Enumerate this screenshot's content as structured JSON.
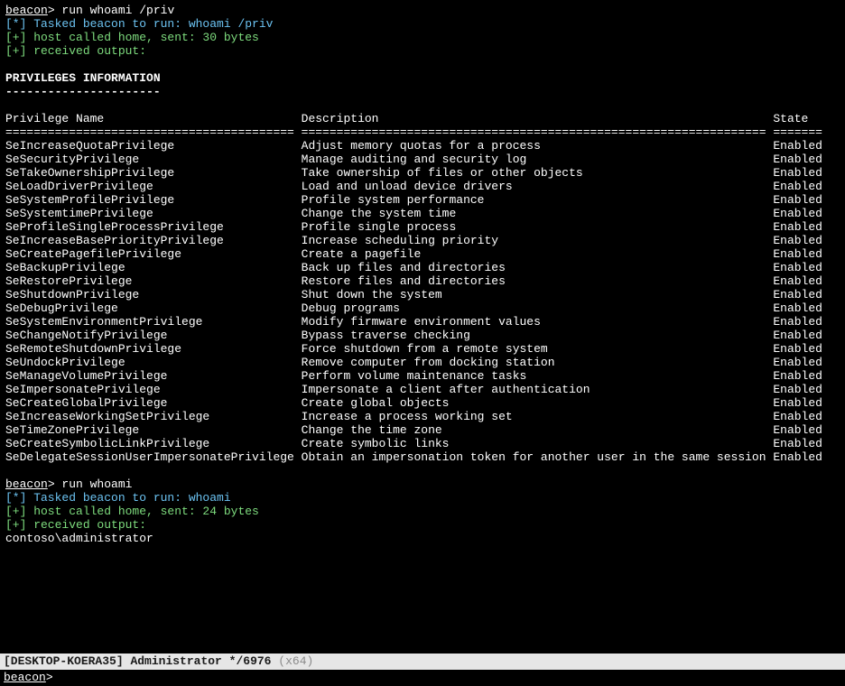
{
  "prompt_label": "beacon",
  "prompt_sep": ">",
  "cmd1": "run whoami /priv",
  "task1": "[*] Tasked beacon to run: whoami /priv",
  "home1": "[+] host called home, sent: 30 bytes",
  "recv1": "[+] received output:",
  "section_title": "PRIVILEGES INFORMATION",
  "section_rule": "----------------------",
  "col1_header": "Privilege Name",
  "col2_header": "Description",
  "col3_header": "State",
  "rows": [
    {
      "name": "SeIncreaseQuotaPrivilege",
      "desc": "Adjust memory quotas for a process",
      "state": "Enabled"
    },
    {
      "name": "SeSecurityPrivilege",
      "desc": "Manage auditing and security log",
      "state": "Enabled"
    },
    {
      "name": "SeTakeOwnershipPrivilege",
      "desc": "Take ownership of files or other objects",
      "state": "Enabled"
    },
    {
      "name": "SeLoadDriverPrivilege",
      "desc": "Load and unload device drivers",
      "state": "Enabled"
    },
    {
      "name": "SeSystemProfilePrivilege",
      "desc": "Profile system performance",
      "state": "Enabled"
    },
    {
      "name": "SeSystemtimePrivilege",
      "desc": "Change the system time",
      "state": "Enabled"
    },
    {
      "name": "SeProfileSingleProcessPrivilege",
      "desc": "Profile single process",
      "state": "Enabled"
    },
    {
      "name": "SeIncreaseBasePriorityPrivilege",
      "desc": "Increase scheduling priority",
      "state": "Enabled"
    },
    {
      "name": "SeCreatePagefilePrivilege",
      "desc": "Create a pagefile",
      "state": "Enabled"
    },
    {
      "name": "SeBackupPrivilege",
      "desc": "Back up files and directories",
      "state": "Enabled"
    },
    {
      "name": "SeRestorePrivilege",
      "desc": "Restore files and directories",
      "state": "Enabled"
    },
    {
      "name": "SeShutdownPrivilege",
      "desc": "Shut down the system",
      "state": "Enabled"
    },
    {
      "name": "SeDebugPrivilege",
      "desc": "Debug programs",
      "state": "Enabled"
    },
    {
      "name": "SeSystemEnvironmentPrivilege",
      "desc": "Modify firmware environment values",
      "state": "Enabled"
    },
    {
      "name": "SeChangeNotifyPrivilege",
      "desc": "Bypass traverse checking",
      "state": "Enabled"
    },
    {
      "name": "SeRemoteShutdownPrivilege",
      "desc": "Force shutdown from a remote system",
      "state": "Enabled"
    },
    {
      "name": "SeUndockPrivilege",
      "desc": "Remove computer from docking station",
      "state": "Enabled"
    },
    {
      "name": "SeManageVolumePrivilege",
      "desc": "Perform volume maintenance tasks",
      "state": "Enabled"
    },
    {
      "name": "SeImpersonatePrivilege",
      "desc": "Impersonate a client after authentication",
      "state": "Enabled"
    },
    {
      "name": "SeCreateGlobalPrivilege",
      "desc": "Create global objects",
      "state": "Enabled"
    },
    {
      "name": "SeIncreaseWorkingSetPrivilege",
      "desc": "Increase a process working set",
      "state": "Enabled"
    },
    {
      "name": "SeTimeZonePrivilege",
      "desc": "Change the time zone",
      "state": "Enabled"
    },
    {
      "name": "SeCreateSymbolicLinkPrivilege",
      "desc": "Create symbolic links",
      "state": "Enabled"
    },
    {
      "name": "SeDelegateSessionUserImpersonatePrivilege",
      "desc": "Obtain an impersonation token for another user in the same session",
      "state": "Enabled"
    }
  ],
  "cmd2": "run whoami",
  "task2": "[*] Tasked beacon to run: whoami",
  "home2": "[+] host called home, sent: 24 bytes",
  "recv2": "[+] received output:",
  "whoami_result": "contoso\\administrator",
  "status_host": "[DESKTOP-KOERA35]",
  "status_user": "Administrator",
  "status_pid": "*/6976",
  "status_arch": "(x64)"
}
